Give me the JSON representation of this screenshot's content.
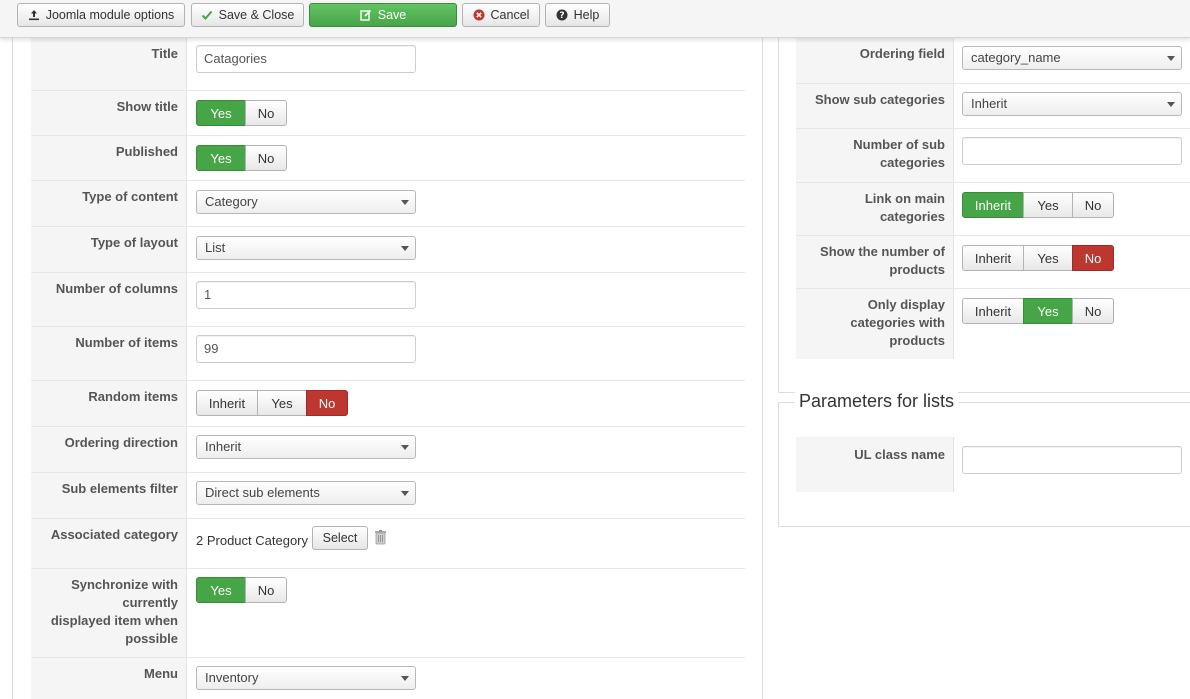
{
  "toolbar": {
    "module_options": "Joomla module options",
    "save_close": "Save & Close",
    "save": "Save",
    "cancel": "Cancel",
    "help": "Help"
  },
  "colors": {
    "green": "#46a546",
    "red": "#bd362f",
    "label_bg": "#f5f5f5"
  },
  "left_form": {
    "title": {
      "label": "Title",
      "value": "Catagories"
    },
    "show_title": {
      "label": "Show title",
      "options": [
        "Yes",
        "No"
      ],
      "selected": "Yes"
    },
    "published": {
      "label": "Published",
      "options": [
        "Yes",
        "No"
      ],
      "selected": "Yes"
    },
    "type_of_content": {
      "label": "Type of content",
      "value": "Category"
    },
    "type_of_layout": {
      "label": "Type of layout",
      "value": "List"
    },
    "number_of_columns": {
      "label": "Number of columns",
      "value": "1"
    },
    "number_of_items": {
      "label": "Number of items",
      "value": "99"
    },
    "random_items": {
      "label": "Random items",
      "options": [
        "Inherit",
        "Yes",
        "No"
      ],
      "selected": "No"
    },
    "ordering_direction": {
      "label": "Ordering direction",
      "value": "Inherit"
    },
    "sub_elements_filter": {
      "label": "Sub elements filter",
      "value": "Direct sub elements"
    },
    "associated_category": {
      "label": "Associated category",
      "value": "2 Product Category",
      "button": "Select"
    },
    "synchronize": {
      "label_lines": [
        "Synchronize with",
        "currently",
        "displayed item when",
        "possible"
      ],
      "options": [
        "Yes",
        "No"
      ],
      "selected": "Yes"
    },
    "menu": {
      "label": "Menu",
      "value": "Inventory"
    }
  },
  "right_form": {
    "ordering_field": {
      "label": "Ordering field",
      "value": "category_name"
    },
    "show_sub_categories": {
      "label": "Show sub categories",
      "value": "Inherit"
    },
    "number_of_sub_categories": {
      "label_lines": [
        "Number of sub",
        "categories"
      ],
      "value": ""
    },
    "link_on_main_categories": {
      "label_lines": [
        "Link on main",
        "categories"
      ],
      "options": [
        "Inherit",
        "Yes",
        "No"
      ],
      "selected": "Inherit"
    },
    "show_number_of_products": {
      "label_lines": [
        "Show the number of",
        "products"
      ],
      "options": [
        "Inherit",
        "Yes",
        "No"
      ],
      "selected": "No"
    },
    "only_display_with_products": {
      "label_lines": [
        "Only display",
        "categories with",
        "products"
      ],
      "options": [
        "Inherit",
        "Yes",
        "No"
      ],
      "selected": "Yes"
    }
  },
  "parameters_for_lists": {
    "legend": "Parameters for lists",
    "ul_class_name": {
      "label": "UL class name",
      "value": ""
    }
  }
}
